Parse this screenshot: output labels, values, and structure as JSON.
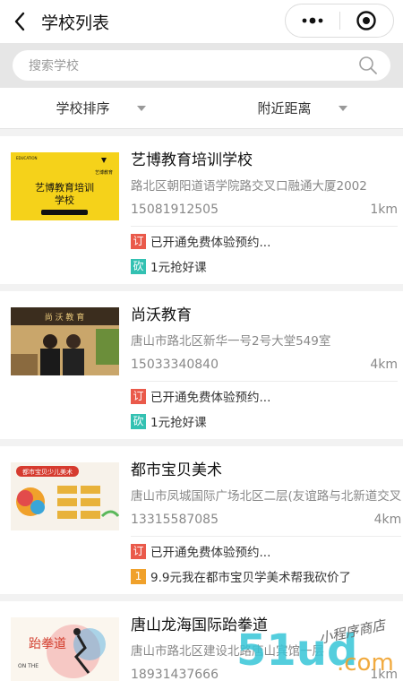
{
  "nav": {
    "title": "学校列表"
  },
  "search": {
    "placeholder": "搜索学校"
  },
  "filters": [
    {
      "label": "学校排序"
    },
    {
      "label": "附近距离"
    }
  ],
  "schools": [
    {
      "name": "艺博教育培训学校",
      "address": "路北区朝阳道语学院路交叉口融通大厦2002",
      "phone": "15081912505",
      "distance": "1km",
      "thumb_text": "艺博教育培训学校",
      "tags": [
        {
          "badge": "订",
          "text": "已开通免费体验预约...",
          "color": "#ea5a4b"
        },
        {
          "badge": "砍",
          "text": "1元抢好课",
          "color": "#33c1b2"
        }
      ]
    },
    {
      "name": "尚沃教育",
      "address": "唐山市路北区新华一号2号大堂549室",
      "phone": "15033340840",
      "distance": "4km",
      "thumb_text": "尚沃教育",
      "tags": [
        {
          "badge": "订",
          "text": "已开通免费体验预约...",
          "color": "#ea5a4b"
        },
        {
          "badge": "砍",
          "text": "1元抢好课",
          "color": "#33c1b2"
        }
      ]
    },
    {
      "name": "都市宝贝美术",
      "address": "唐山市凤城国际广场北区二层(友谊路与北新道交叉",
      "phone": "13315587085",
      "distance": "4km",
      "thumb_text": "都市宝贝少儿美术",
      "tags": [
        {
          "badge": "订",
          "text": "已开通免费体验预约...",
          "color": "#ea5a4b"
        },
        {
          "badge": "1",
          "text": "9.9元我在都市宝贝学美术帮我砍价了",
          "color": "#f0a12b"
        }
      ]
    },
    {
      "name": "唐山龙海国际跆拳道",
      "address": "唐山市路北区建设北路唐山宾馆一层",
      "phone": "18931437666",
      "distance": "1km",
      "thumb_text": "跆拳道",
      "tags": []
    }
  ],
  "watermark": {
    "main": "51ud",
    "suffix": ".com",
    "script": "小程序商店"
  }
}
